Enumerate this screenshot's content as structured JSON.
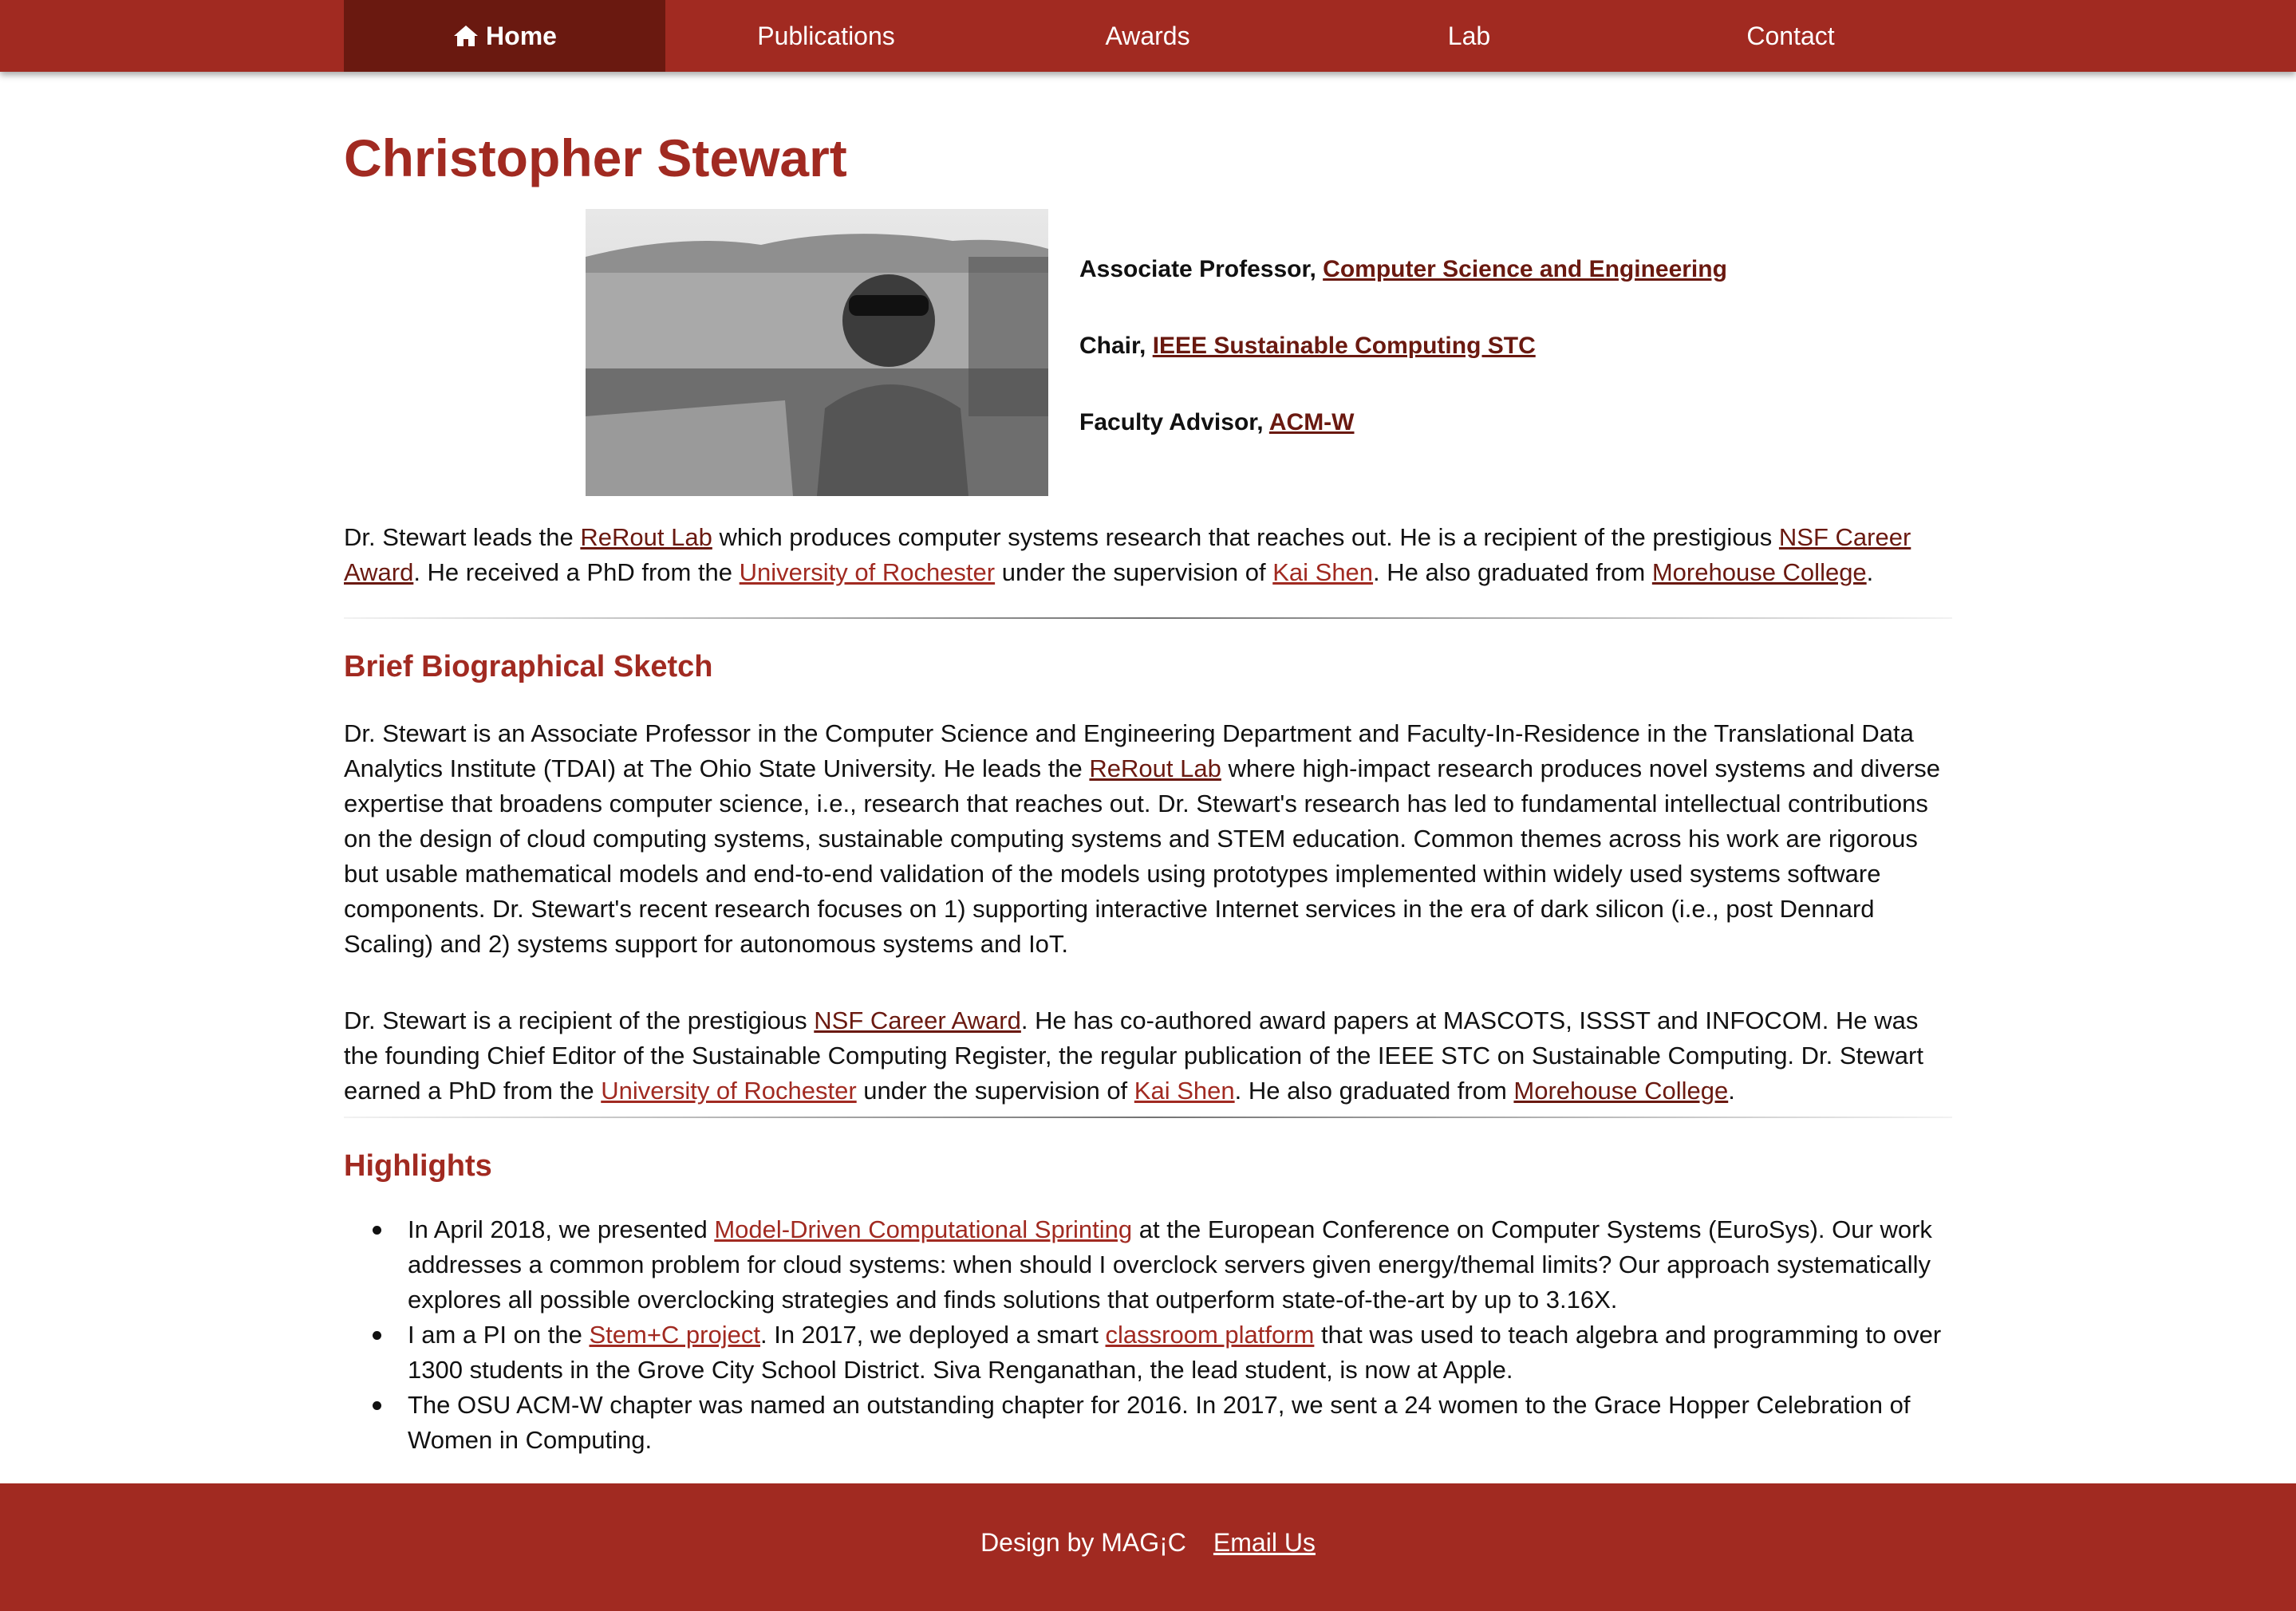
{
  "nav": {
    "items": [
      {
        "label": "Home",
        "icon": "home-icon",
        "active": true
      },
      {
        "label": "Publications"
      },
      {
        "label": "Awards"
      },
      {
        "label": "Lab"
      },
      {
        "label": "Contact"
      }
    ]
  },
  "page": {
    "title": "Christopher Stewart",
    "roles": [
      {
        "prefix": "Associate Professor, ",
        "link": "Computer Science and Engineering"
      },
      {
        "prefix": "Chair, ",
        "link": "IEEE Sustainable Computing STC"
      },
      {
        "prefix": "Faculty Advisor, ",
        "link": "ACM-W"
      }
    ],
    "intro": {
      "t1": "Dr. Stewart leads the ",
      "l1": "ReRout Lab",
      "t2": " which produces computer systems research that reaches out. He is a recipient of the prestigious ",
      "l2": "NSF Career Award",
      "t3": ". He received a PhD from the ",
      "l3": "University of Rochester",
      "t4": " under the supervision of ",
      "l4": "Kai Shen",
      "t5": ". He also graduated from ",
      "l5": "Morehouse College",
      "t6": "."
    }
  },
  "bio": {
    "heading": "Brief Biographical Sketch",
    "p1": {
      "t1": "Dr. Stewart is an Associate Professor in the Computer Science and Engineering Department and Faculty-In-Residence in the Translational Data Analytics Institute (TDAI) at The Ohio State University. He leads the ",
      "l1": "ReRout Lab",
      "t2": " where high-impact research produces novel systems and diverse expertise that broadens computer science, i.e., research that reaches out. Dr. Stewart's research has led to fundamental intellectual contributions on the design of cloud computing systems, sustainable computing systems and STEM education. Common themes across his work are rigorous but usable mathematical models and end-to-end validation of the models using prototypes implemented within widely used systems software components. Dr. Stewart's recent research focuses on 1) supporting interactive Internet services in the era of dark silicon (i.e., post Dennard Scaling) and 2) systems support for autonomous systems and IoT."
    },
    "p2": {
      "t1": "Dr. Stewart is a recipient of the prestigious ",
      "l1": "NSF Career Award",
      "t2": ". He has co-authored award papers at MASCOTS, ISSST and INFOCOM.  He was the founding Chief Editor of the Sustainable Computing Register, the regular publication of the IEEE STC on Sustainable Computing. Dr. Stewart earned a PhD from the ",
      "l2": "University of Rochester",
      "t3": " under the supervision of ",
      "l3": "Kai Shen",
      "t4": ". He also graduated from ",
      "l4": "Morehouse College",
      "t5": "."
    }
  },
  "highlights": {
    "heading": "Highlights",
    "h1": {
      "t1": "In April 2018, we presented ",
      "l1": "Model-Driven Computational Sprinting",
      "t2": " at the European Conference on Computer Systems (EuroSys). Our work addresses a common problem for cloud systems: when should I overclock servers given energy/themal limits? Our approach systematically explores all possible overclocking strategies and finds solutions that outperform state-of-the-art by up to 3.16X."
    },
    "h2": {
      "t1": "I am a PI on the ",
      "l1": "Stem+C project",
      "t2": ". In 2017, we deployed a smart ",
      "l2": "classroom platform",
      "t3": " that was used to teach algebra and programming to over 1300 students in the Grove City School District. Siva Renganathan, the lead student, is now at Apple."
    },
    "h3": {
      "t1": "The OSU ACM-W chapter was named an outstanding chapter for 2016. In 2017, we sent a 24 women to the Grace Hopper Celebration of Women in Computing."
    }
  },
  "footer": {
    "design": "Design by MAG¡C",
    "email": "Email Us"
  },
  "colors": {
    "brand": "#a12a21",
    "nav_active": "#6a1910",
    "link_dark": "#6a1910"
  }
}
